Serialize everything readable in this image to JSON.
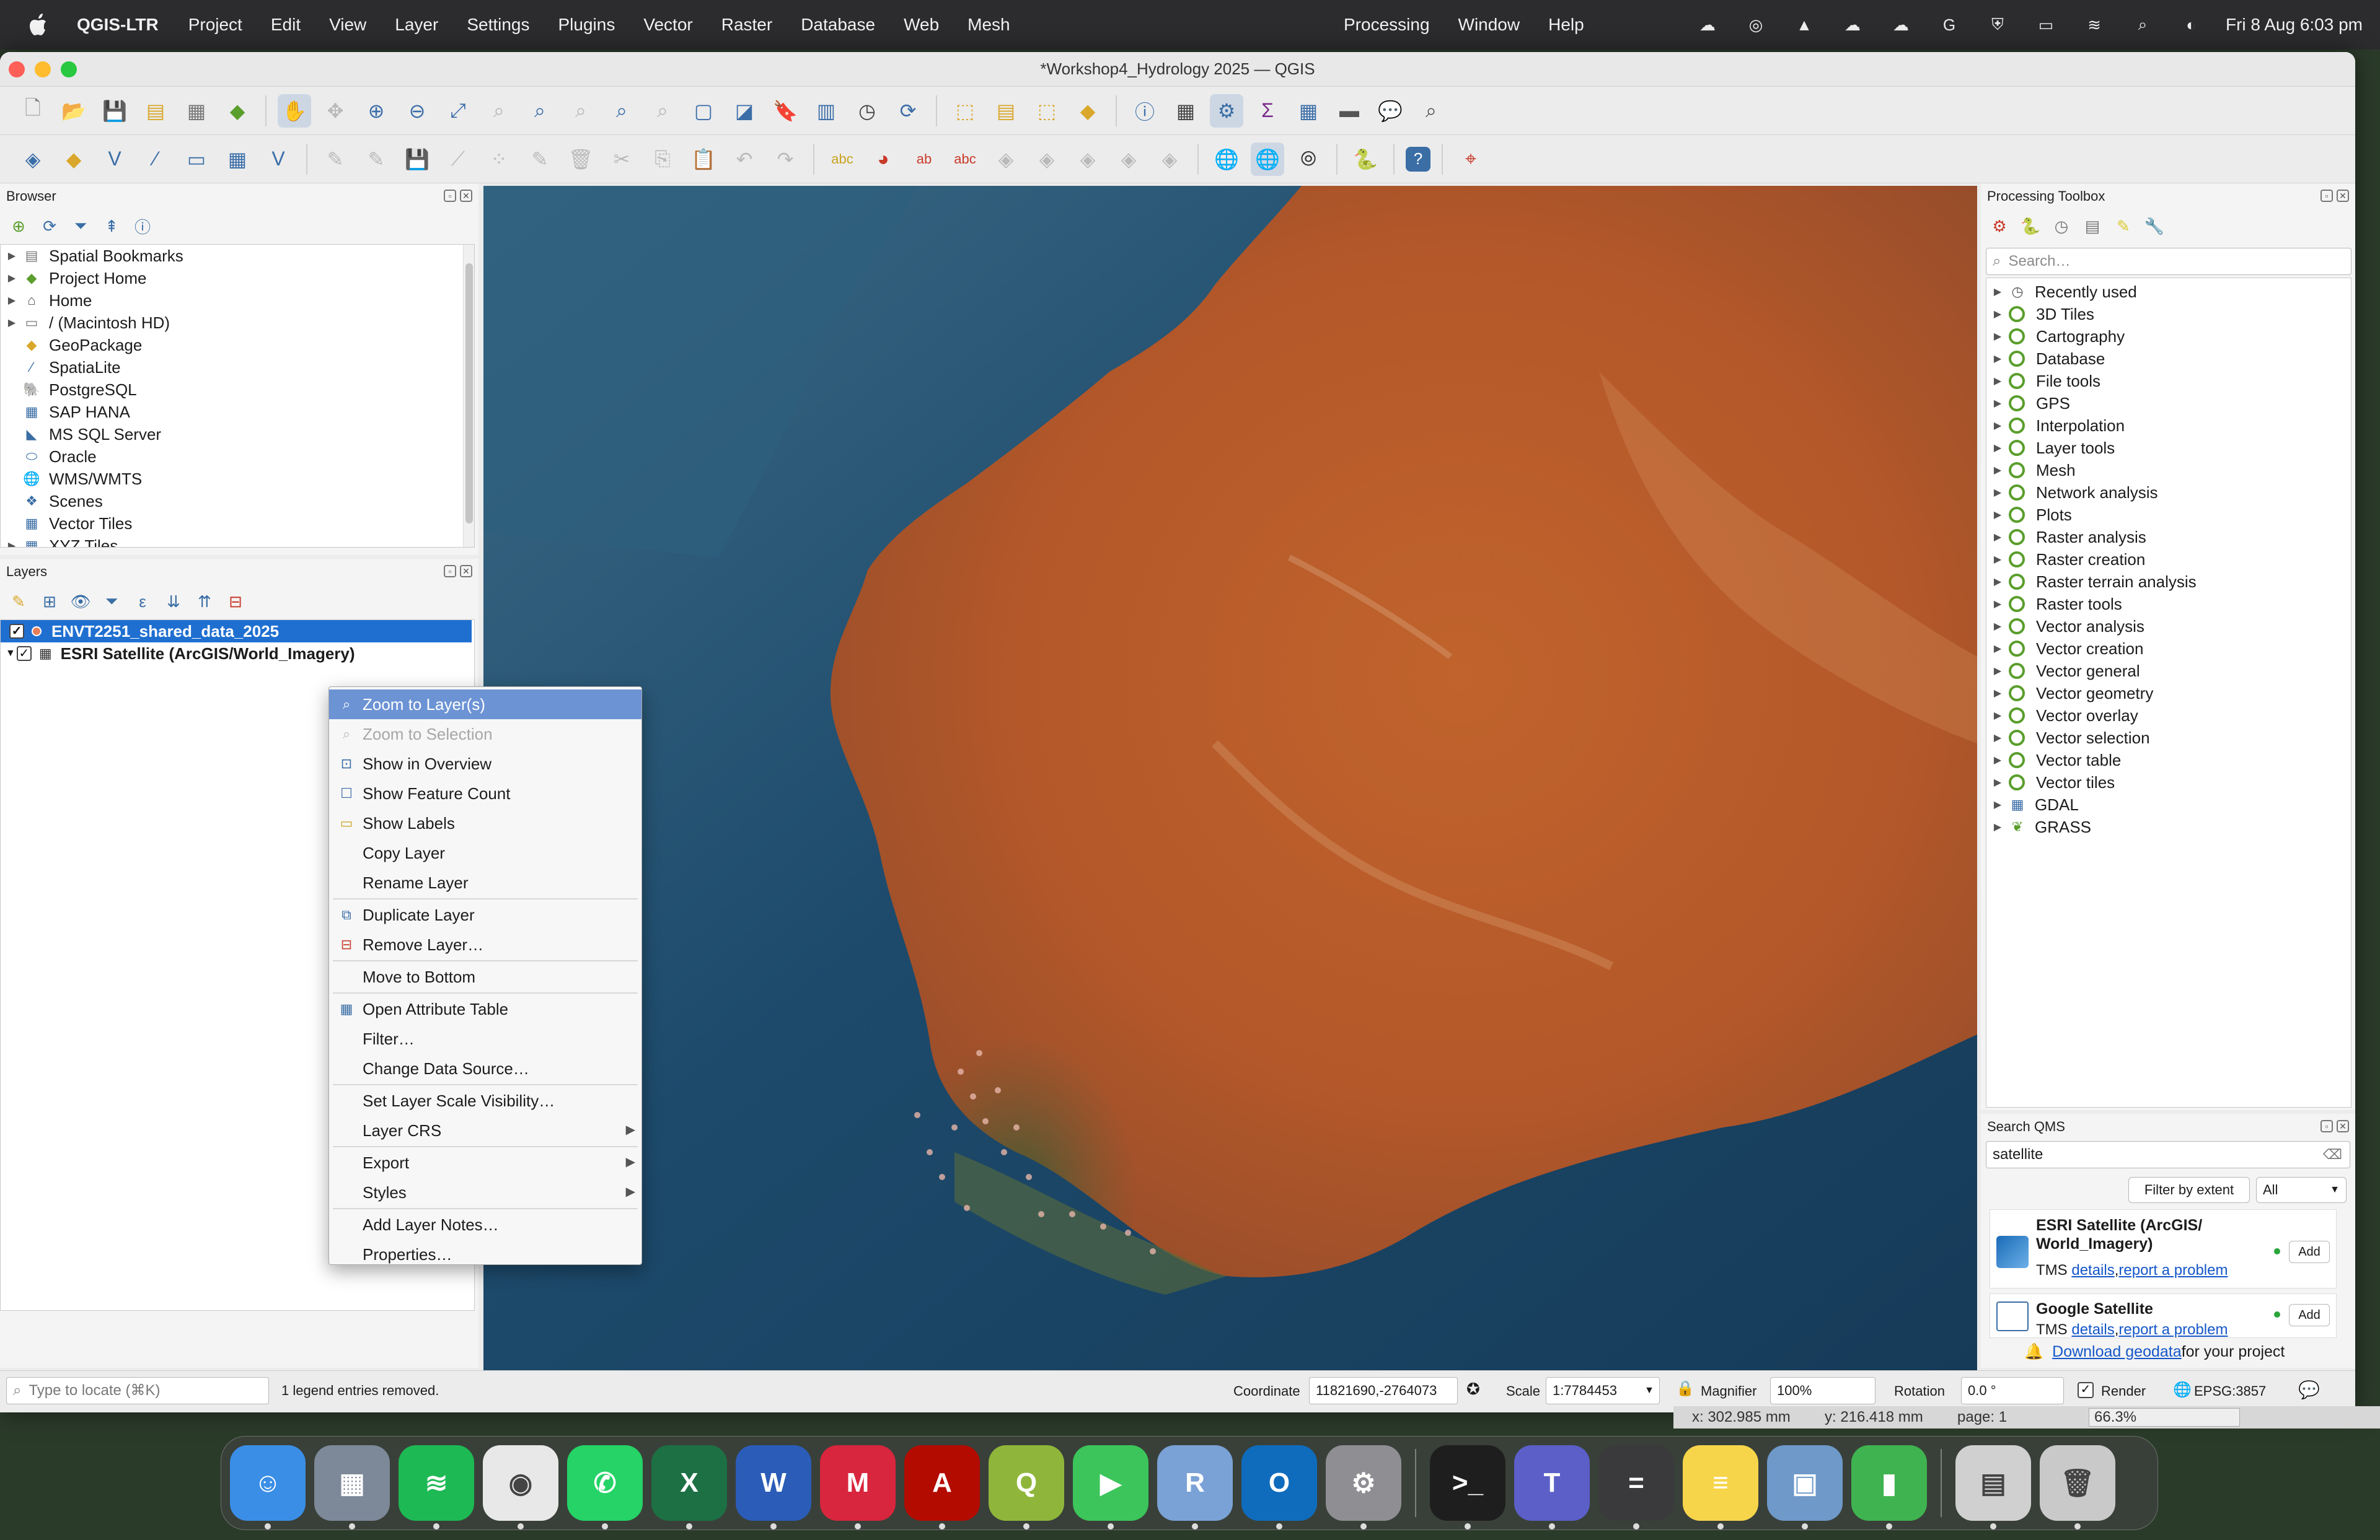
{
  "menubar": {
    "app_name": "QGIS-LTR",
    "items": [
      "Project",
      "Edit",
      "View",
      "Layer",
      "Settings",
      "Plugins",
      "Vector",
      "Raster",
      "Database",
      "Web",
      "Mesh"
    ],
    "items_mid": [
      "Processing",
      "Window",
      "Help"
    ],
    "clock": "Fri 8 Aug  6:03 pm"
  },
  "window": {
    "title": "*Workshop4_Hydrology 2025 — QGIS"
  },
  "browser": {
    "title": "Browser",
    "items": [
      {
        "label": "Spatial Bookmarks",
        "icon": "bookmark-icon",
        "expand": true
      },
      {
        "label": "Project Home",
        "icon": "project-home-icon",
        "expand": true
      },
      {
        "label": "Home",
        "icon": "home-icon",
        "expand": true
      },
      {
        "label": "/ (Macintosh HD)",
        "icon": "folder-icon",
        "expand": true
      },
      {
        "label": "GeoPackage",
        "icon": "geopackage-icon",
        "expand": false
      },
      {
        "label": "SpatiaLite",
        "icon": "spatialite-icon",
        "expand": false
      },
      {
        "label": "PostgreSQL",
        "icon": "postgresql-icon",
        "expand": false
      },
      {
        "label": "SAP HANA",
        "icon": "sap-hana-icon",
        "expand": false
      },
      {
        "label": "MS SQL Server",
        "icon": "mssql-icon",
        "expand": false
      },
      {
        "label": "Oracle",
        "icon": "oracle-icon",
        "expand": false
      },
      {
        "label": "WMS/WMTS",
        "icon": "globe-icon",
        "expand": false
      },
      {
        "label": "Scenes",
        "icon": "scenes-icon",
        "expand": false
      },
      {
        "label": "Vector Tiles",
        "icon": "grid-icon",
        "expand": false
      },
      {
        "label": "XYZ Tiles",
        "icon": "grid-icon",
        "expand": true
      }
    ]
  },
  "layers": {
    "title": "Layers",
    "items": [
      {
        "label": "ENVT2251_shared_data_2025",
        "selected": true
      },
      {
        "label": "ESRI Satellite (ArcGIS/World_Imagery)",
        "selected": false
      }
    ]
  },
  "context_menu": {
    "items": [
      {
        "label": "Zoom to Layer(s)",
        "icon": "zoom-layer-icon",
        "state": "highlighted"
      },
      {
        "label": "Zoom to Selection",
        "icon": "zoom-selection-icon",
        "state": "disabled"
      },
      {
        "label": "Show in Overview",
        "icon": "overview-icon",
        "state": "normal"
      },
      {
        "label": "Show Feature Count",
        "icon": "checkbox-icon",
        "state": "normal"
      },
      {
        "label": "Show Labels",
        "icon": "labels-icon",
        "state": "normal"
      },
      {
        "label": "Copy Layer",
        "icon": "",
        "state": "normal"
      },
      {
        "label": "Rename Layer",
        "icon": "",
        "state": "normal"
      },
      {
        "label": "Duplicate Layer",
        "icon": "duplicate-icon",
        "state": "normal"
      },
      {
        "label": "Remove Layer…",
        "icon": "remove-icon",
        "state": "normal"
      },
      {
        "label": "Move to Bottom",
        "icon": "",
        "state": "normal"
      },
      {
        "label": "Open Attribute Table",
        "icon": "table-icon",
        "state": "normal"
      },
      {
        "label": "Filter…",
        "icon": "",
        "state": "normal"
      },
      {
        "label": "Change Data Source…",
        "icon": "",
        "state": "normal"
      },
      {
        "label": "Set Layer Scale Visibility…",
        "icon": "",
        "state": "normal"
      },
      {
        "label": "Layer CRS",
        "icon": "",
        "state": "submenu"
      },
      {
        "label": "Export",
        "icon": "",
        "state": "submenu"
      },
      {
        "label": "Styles",
        "icon": "",
        "state": "submenu"
      },
      {
        "label": "Add Layer Notes…",
        "icon": "",
        "state": "normal"
      },
      {
        "label": "Properties…",
        "icon": "",
        "state": "normal"
      }
    ]
  },
  "processing": {
    "title": "Processing Toolbox",
    "search_placeholder": "Search…",
    "items": [
      "Recently used",
      "3D Tiles",
      "Cartography",
      "Database",
      "File tools",
      "GPS",
      "Interpolation",
      "Layer tools",
      "Mesh",
      "Network analysis",
      "Plots",
      "Raster analysis",
      "Raster creation",
      "Raster terrain analysis",
      "Raster tools",
      "Vector analysis",
      "Vector creation",
      "Vector general",
      "Vector geometry",
      "Vector overlay",
      "Vector selection",
      "Vector table",
      "Vector tiles",
      "GDAL",
      "GRASS"
    ]
  },
  "qms": {
    "title": "Search QMS",
    "search_value": "satellite",
    "filter_button": "Filter by extent",
    "filter_select": "All",
    "results": [
      {
        "name": "ESRI Satellite (ArcGIS/\nWorld_Imagery)",
        "type": "TMS",
        "details": "details",
        "report": "report a problem",
        "add": "Add"
      },
      {
        "name": "Google Satellite",
        "type": "TMS",
        "details": "details",
        "report": "report a problem",
        "add": "Add"
      }
    ],
    "download_link": "Download geodata",
    "download_suffix": " for your project"
  },
  "status": {
    "locate_placeholder": "Type to locate (⌘K)",
    "message": "1 legend entries removed.",
    "coordinate_label": "Coordinate",
    "coordinate_value": "11821690,-2764073",
    "scale_label": "Scale",
    "scale_value": "1:7784453",
    "magnifier_label": "Magnifier",
    "magnifier_value": "100%",
    "rotation_label": "Rotation",
    "rotation_value": "0.0 °",
    "render_label": "Render",
    "crs": "EPSG:3857"
  },
  "behind_window": {
    "x": "x: 302.985 mm",
    "y": "y: 216.418 mm",
    "page": "page: 1",
    "zoom": "66.3%"
  },
  "dock": {
    "apps": [
      {
        "name": "finder",
        "color": "#3a8ee6",
        "glyph": "☺"
      },
      {
        "name": "launchpad",
        "color": "#7d8899",
        "glyph": "▦"
      },
      {
        "name": "spotify",
        "color": "#1db954",
        "glyph": "≋"
      },
      {
        "name": "chrome",
        "color": "#e8e8e8",
        "glyph": "◉"
      },
      {
        "name": "whatsapp",
        "color": "#25d366",
        "glyph": "✆"
      },
      {
        "name": "excel",
        "color": "#1d7044",
        "glyph": "X"
      },
      {
        "name": "word",
        "color": "#2b5cb8",
        "glyph": "W"
      },
      {
        "name": "mendeley",
        "color": "#d7263d",
        "glyph": "M"
      },
      {
        "name": "acrobat",
        "color": "#b30b00",
        "glyph": "A"
      },
      {
        "name": "qgis",
        "color": "#8fb63a",
        "glyph": "Q"
      },
      {
        "name": "facetime",
        "color": "#3cc55a",
        "glyph": "▶"
      },
      {
        "name": "rstudio",
        "color": "#7aa2d6",
        "glyph": "R"
      },
      {
        "name": "outlook",
        "color": "#0f6cbd",
        "glyph": "O"
      },
      {
        "name": "system-settings",
        "color": "#8e8e93",
        "glyph": "⚙"
      },
      {
        "name": "terminal",
        "color": "#1e1e1e",
        "glyph": ">_"
      },
      {
        "name": "teams",
        "color": "#5b5fc7",
        "glyph": "T"
      },
      {
        "name": "calculator",
        "color": "#3a3a3c",
        "glyph": "="
      },
      {
        "name": "notes",
        "color": "#f7d54a",
        "glyph": "≡"
      },
      {
        "name": "preview",
        "color": "#6e99c9",
        "glyph": "▣"
      },
      {
        "name": "numbers",
        "color": "#3fb34f",
        "glyph": "▮"
      },
      {
        "name": "documents",
        "color": "#d0d0d0",
        "glyph": "▤"
      },
      {
        "name": "trash",
        "color": "#c9c9c9",
        "glyph": "🗑"
      }
    ]
  },
  "colors": {
    "selection": "#1f6fd1",
    "menu_highlight": "#6c93d4",
    "qgis_green": "#5a9e2c",
    "link": "#1456c9"
  }
}
